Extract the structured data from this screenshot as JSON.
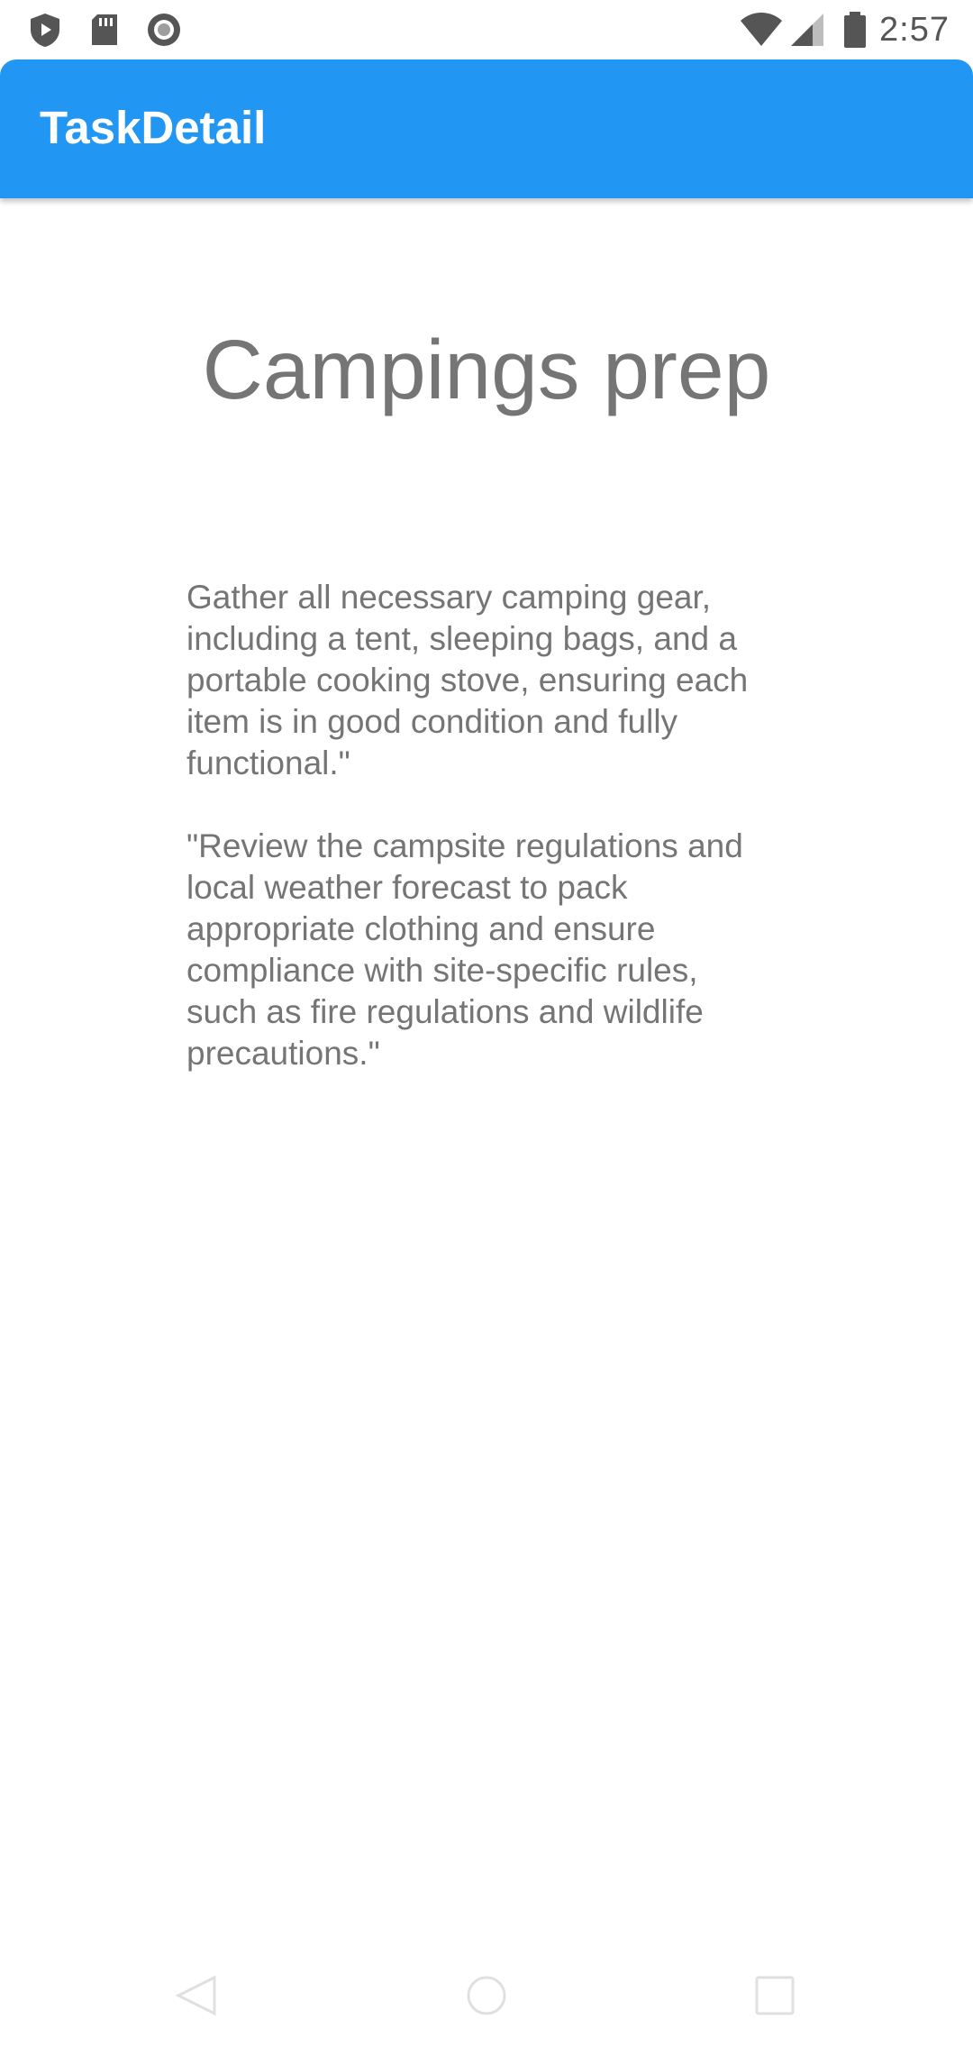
{
  "status_bar": {
    "time": "2:57",
    "icons": [
      "play-protect-icon",
      "sd-card-icon",
      "record-icon",
      "wifi-icon",
      "signal-icon",
      "battery-icon"
    ]
  },
  "app_bar": {
    "title": "TaskDetail",
    "color": "#2196f3"
  },
  "task": {
    "title": "Campings prep",
    "description_paragraphs": [
      "Gather all necessary camping gear, including a tent, sleeping bags, and a portable cooking stove, ensuring each item is in good condition and fully functional.\"",
      "\"Review the campsite regulations and local weather forecast to pack appropriate clothing and ensure compliance with site-specific rules, such as fire regulations and wildlife precautions.\""
    ]
  },
  "nav_bar": {
    "icons": [
      "back-icon",
      "home-icon",
      "recents-icon"
    ]
  }
}
